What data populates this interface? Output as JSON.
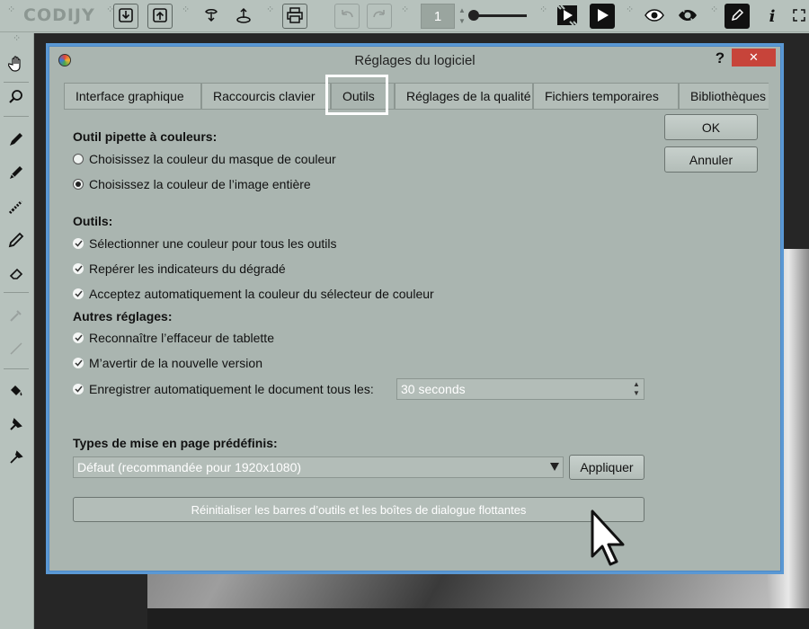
{
  "app": {
    "logo_text": "CODIJY",
    "page_number": "1"
  },
  "toolbar": {
    "icons": [
      "download-icon",
      "upload-icon",
      "hand-drop-icon",
      "drop-upload-icon",
      "print-icon",
      "undo-icon",
      "redo-icon",
      "film-play-icon",
      "play-icon",
      "eye-icon",
      "eye-dots-icon",
      "pen-icon",
      "info-icon",
      "expand-icon"
    ]
  },
  "leftbar": {
    "icons": [
      "hand-icon",
      "zoom-icon",
      "marker-icon",
      "marker-alt-icon",
      "pixel-brush-icon",
      "pencil-icon",
      "eraser-icon",
      "dropper-disabled-icon",
      "pen-disabled-icon",
      "paint-bucket-icon",
      "stamp-icon",
      "eyedropper-icon"
    ]
  },
  "dialog": {
    "title": "Réglages du logiciel",
    "help_label": "?",
    "close_label": "✕",
    "tabs": [
      {
        "label": "Interface graphique"
      },
      {
        "label": "Raccourcis clavier"
      },
      {
        "label": "Outils"
      },
      {
        "label": "Réglages de la qualité"
      },
      {
        "label": "Fichiers temporaires"
      },
      {
        "label": "Bibliothèques"
      }
    ],
    "active_tab": "Outils",
    "ok_label": "OK",
    "cancel_label": "Annuler",
    "picker": {
      "title": "Outil pipette à couleurs:",
      "options": [
        {
          "label": "Choisissez la couleur du masque de couleur",
          "selected": false
        },
        {
          "label": "Choisissez la couleur de l’image entière",
          "selected": true
        }
      ]
    },
    "tools": {
      "title": "Outils:",
      "options": [
        {
          "label": "Sélectionner une couleur pour tous les outils",
          "checked": true
        },
        {
          "label": "Repérer les indicateurs du dégradé",
          "checked": true
        },
        {
          "label": "Acceptez automatiquement la couleur du sélecteur de couleur",
          "checked": true
        }
      ]
    },
    "other": {
      "title": "Autres réglages:",
      "options": [
        {
          "label": "Reconnaître l’effaceur de tablette",
          "checked": true
        },
        {
          "label": "M’avertir de la nouvelle version",
          "checked": true
        },
        {
          "label": "Enregistrer automatiquement le document tous les:",
          "checked": true
        }
      ],
      "autosave_value": "30 seconds"
    },
    "layouts": {
      "title": "Types de mise en page prédéfinis:",
      "selected": "Défaut (recommandée pour 1920x1080)",
      "apply_label": "Appliquer"
    },
    "reset_label": "Réinitialiser les barres d’outils et les boîtes de dialogue flottantes"
  }
}
